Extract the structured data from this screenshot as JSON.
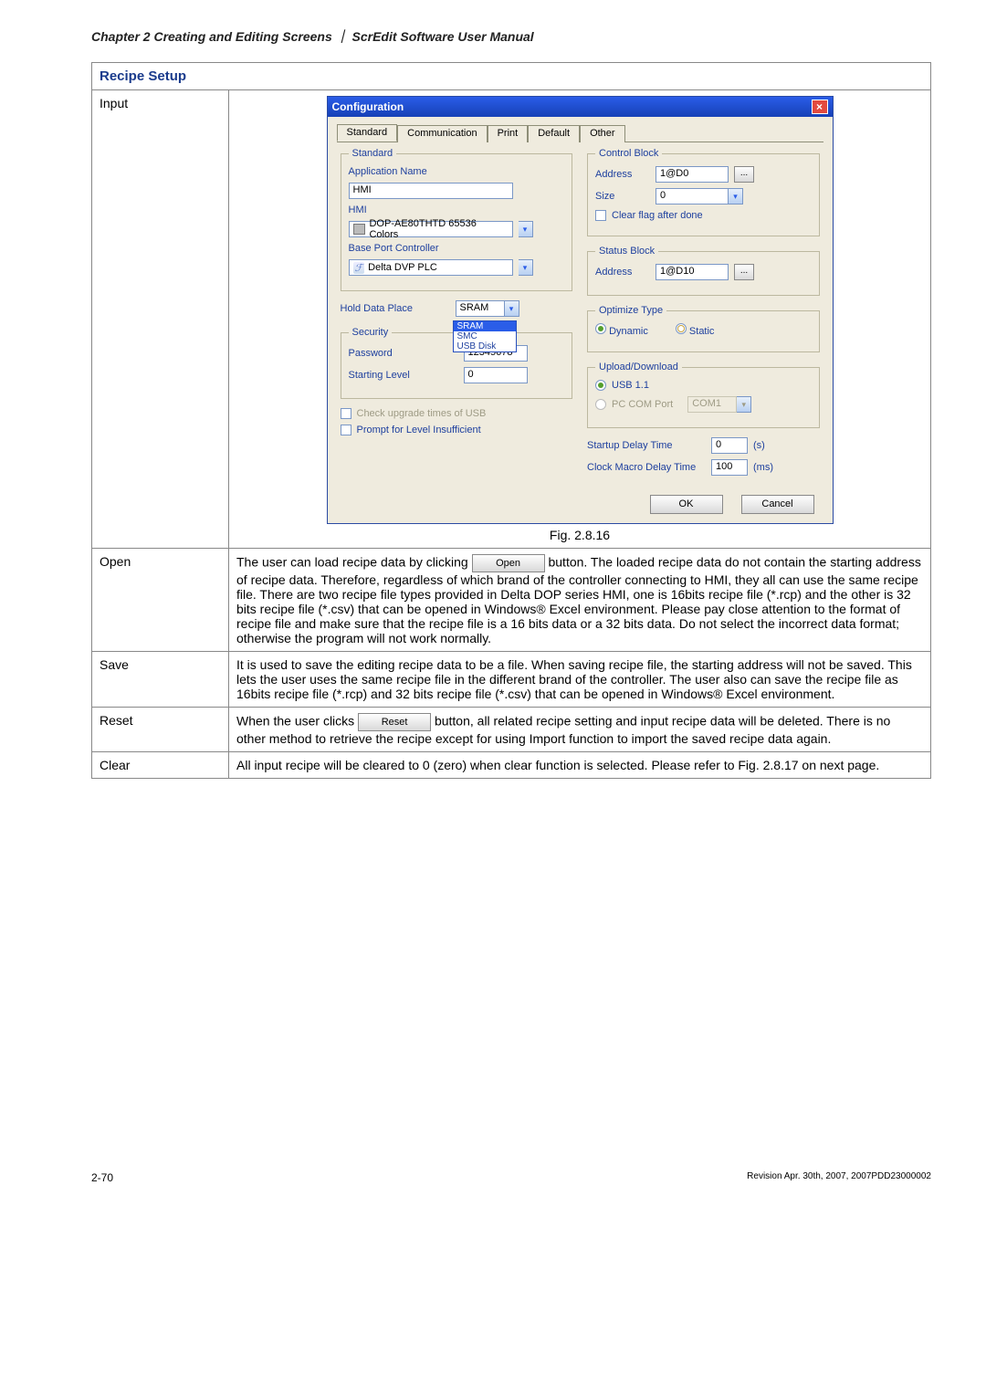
{
  "header": {
    "chapter": "Chapter 2  Creating and Editing Screens",
    "separator": "｜",
    "manual": "ScrEdit Software User Manual"
  },
  "section_title": "Recipe Setup",
  "rows": {
    "input_label": "Input",
    "open_label": "Open",
    "save_label": "Save",
    "reset_label": "Reset",
    "clear_label": "Clear"
  },
  "figure_caption": "Fig. 2.8.16",
  "dialog": {
    "title": "Configuration",
    "tabs": [
      "Standard",
      "Communication",
      "Print",
      "Default",
      "Other"
    ],
    "groups": {
      "standard": {
        "legend": "Standard",
        "app_name_label": "Application Name",
        "app_name_value": "HMI",
        "hmi_label": "HMI",
        "hmi_value": "DOP-AE80THTD 65536 Colors",
        "base_port_label": "Base Port Controller",
        "base_port_value": "Delta DVP PLC"
      },
      "holddata": {
        "label": "Hold Data Place",
        "selected": "SRAM",
        "options": [
          "SRAM",
          "SMC",
          "USB Disk"
        ]
      },
      "security": {
        "legend": "Security",
        "password_label": "Password",
        "password_value": "12345678",
        "start_level_label": "Starting Level",
        "start_level_value": "0"
      },
      "check_upgrade": "Check upgrade times of USB",
      "prompt_level": "Prompt for Level Insufficient",
      "control_block": {
        "legend": "Control Block",
        "address_label": "Address",
        "address_value": "1@D0",
        "size_label": "Size",
        "size_value": "0",
        "clear_flag": "Clear flag after done"
      },
      "status_block": {
        "legend": "Status Block",
        "address_label": "Address",
        "address_value": "1@D10"
      },
      "optimize": {
        "legend": "Optimize Type",
        "dynamic": "Dynamic",
        "static": "Static"
      },
      "upload": {
        "legend": "Upload/Download",
        "usb": "USB 1.1",
        "pc_com": "PC COM Port",
        "com_value": "COM1"
      },
      "startup_delay_label": "Startup Delay Time",
      "startup_delay_value": "0",
      "startup_delay_unit": "(s)",
      "clock_macro_label": "Clock Macro Delay Time",
      "clock_macro_value": "100",
      "clock_macro_unit": "(ms)"
    },
    "ok": "OK",
    "cancel": "Cancel"
  },
  "open_text": {
    "p1a": "The user can load recipe data by clicking ",
    "btn": "Open",
    "p1b": " button. The loaded recipe data do not contain the starting address of recipe data. Therefore, regardless of which brand of the controller connecting to HMI, they all can use the same recipe file. There are two recipe file types provided in Delta DOP series HMI, one is 16bits recipe file (*.rcp) and the other is 32 bits recipe file (*.csv) that can be opened in Windows® Excel environment. Please pay close attention to the format of recipe file and make sure that the recipe file is a 16 bits data or a 32 bits data. Do not select the incorrect data format; otherwise the program will not work normally."
  },
  "save_text": "It is used to save the editing recipe data to be a file. When saving recipe file, the starting address will not be saved. This lets the user uses the same recipe file in the different brand of the controller. The user also can save the recipe file as 16bits recipe file (*.rcp) and 32 bits recipe file (*.csv) that can be opened in Windows® Excel environment.",
  "reset_text": {
    "p1a": "When the user clicks ",
    "btn": "Reset",
    "p1b": " button, all related recipe setting and input recipe data will be deleted. There is no other method to retrieve the recipe except for using Import function to import the saved recipe data again."
  },
  "clear_text": "All input recipe will be cleared to 0 (zero) when clear function is selected. Please refer to Fig. 2.8.17 on next page.",
  "footer": {
    "page": "2-70",
    "revision": "Revision Apr. 30th, 2007, 2007PDD23000002"
  }
}
